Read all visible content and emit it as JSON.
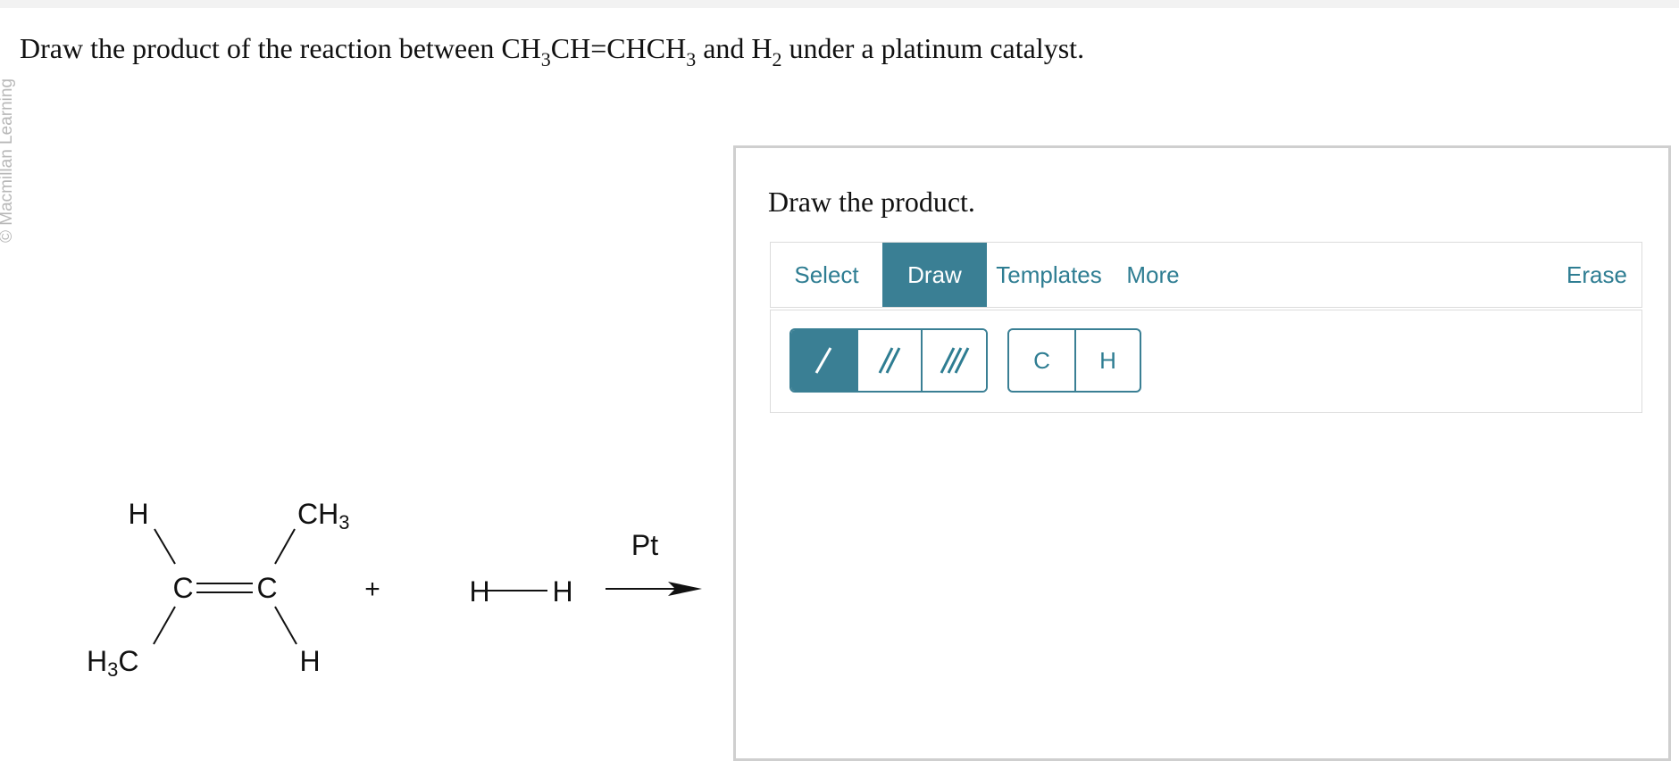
{
  "question": {
    "p1": "Draw the product of the reaction between CH",
    "s1": "3",
    "p2": "CH=CHCH",
    "s2": "3",
    "p3": " and H",
    "s3": "2",
    "p4": " under a platinum catalyst."
  },
  "side_credit": "© Macmillan Learning",
  "reaction": {
    "h_top_left": "H",
    "ch3_main": "CH",
    "ch3_sub": "3",
    "c_left": "C",
    "c_right": "C",
    "h3c_main": "H",
    "h3c_sub": "3",
    "h3c_tail": "C",
    "h_bottom_right": "H",
    "plus": "+",
    "h2_left": "H",
    "h2_right": "H",
    "catalyst": "Pt"
  },
  "panel": {
    "title": "Draw the product.",
    "tabs": {
      "select": "Select",
      "draw": "Draw",
      "templates": "Templates",
      "more": "More",
      "erase": "Erase"
    },
    "tools": {
      "single_bond_icon": "single-bond-icon",
      "double_bond_icon": "double-bond-icon",
      "triple_bond_icon": "triple-bond-icon",
      "atom_c": "C",
      "atom_h": "H"
    }
  },
  "colors": {
    "accent": "#3a7f94",
    "accent_text": "#2e7d92",
    "border": "#cfcfcf"
  }
}
